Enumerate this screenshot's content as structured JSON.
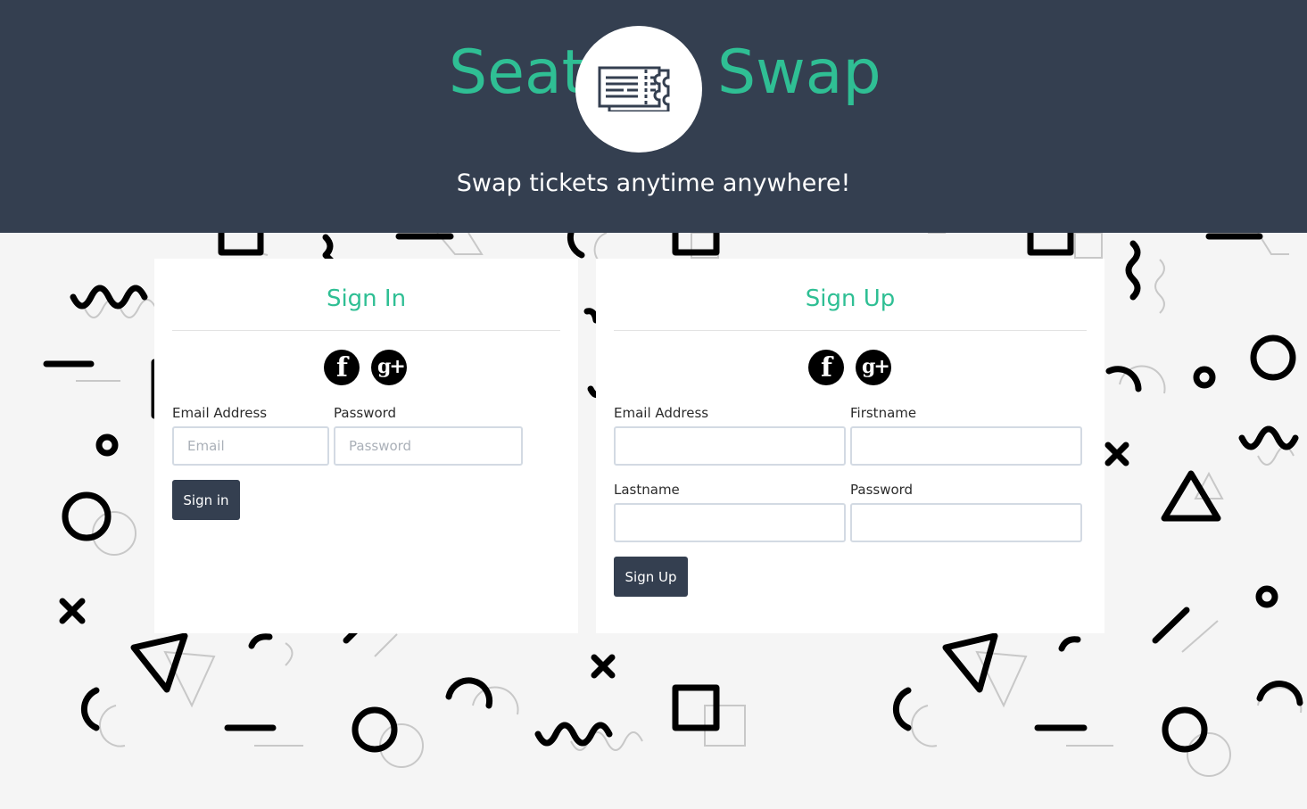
{
  "header": {
    "brand_left": "Seat",
    "brand_right": "Swap",
    "tagline": "Swap tickets anytime anywhere!"
  },
  "colors": {
    "accent": "#2fbf94",
    "header_bg": "#343f50",
    "page_bg": "#f5f5f5",
    "button_bg": "#343f50"
  },
  "signin": {
    "title": "Sign In",
    "social_icons": [
      "facebook-icon",
      "google-plus-icon"
    ],
    "email_label": "Email Address",
    "email_placeholder": "Email",
    "password_label": "Password",
    "password_placeholder": "Password",
    "button_label": "Sign in"
  },
  "signup": {
    "title": "Sign Up",
    "social_icons": [
      "facebook-icon",
      "google-plus-icon"
    ],
    "email_label": "Email Address",
    "firstname_label": "Firstname",
    "lastname_label": "Lastname",
    "password_label": "Password",
    "button_label": "Sign Up"
  },
  "icons": {
    "logo": "ticket-icon",
    "facebook": "f",
    "google_plus": "g+"
  }
}
